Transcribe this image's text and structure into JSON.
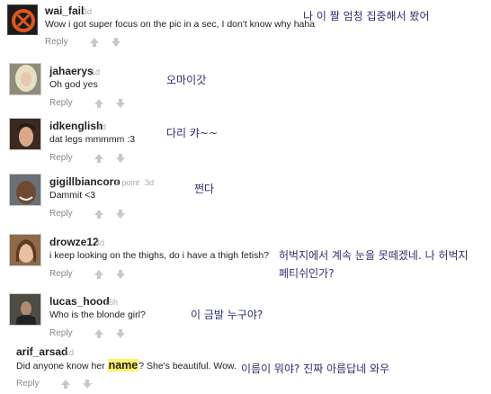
{
  "comments": [
    {
      "username": "wai_fail",
      "time": "3d",
      "points": "",
      "text": "Wow i got super focus on the pic in a sec, I don't know why haha",
      "reply": "Reply",
      "note": "나 이 짤 엄청 집중해서 봤어",
      "avatar": "orange-logo-avatar"
    },
    {
      "username": "jahaerys",
      "time": "1d",
      "points": "",
      "text": "Oh god yes",
      "reply": "Reply",
      "note": "오마이갓",
      "avatar": "blonde-person-avatar"
    },
    {
      "username": "idkenglish",
      "time": "1d",
      "points": "",
      "text": "dat legs mmmmm :3",
      "reply": "Reply",
      "note": "다리 캬~~",
      "avatar": "dark-hair-person-avatar"
    },
    {
      "username": "gigillbiancoro",
      "time": "3d",
      "points": "1 point",
      "text": "Dammit <3",
      "reply": "Reply",
      "note": "쩐다",
      "avatar": "smiling-man-avatar"
    },
    {
      "username": "drowze12",
      "time": "3d",
      "points": "",
      "text": "i keep looking on the thighs, do i have a thigh fetish?",
      "reply": "Reply",
      "note": "허벅지에서 계속 눈을 못떼겠네. 나 허벅지",
      "note2": "페티쉬인가?",
      "avatar": "brunette-woman-avatar"
    },
    {
      "username": "lucas_hood",
      "time": "16h",
      "points": "",
      "text": "Who is the blonde girl?",
      "reply": "Reply",
      "note": "이 금발 누구야?",
      "avatar": "dark-figure-avatar"
    },
    {
      "username": "arif_arsad",
      "time": "1d",
      "points": "",
      "text_before": "Did anyone know her ",
      "text_highlight": "name",
      "text_after": "? She's beautiful. Wow.",
      "reply": "Reply",
      "note": "이름이 뭐야? 진짜 아름답네 와우",
      "avatar": ""
    }
  ],
  "colors": {
    "annotation": "#2d2f6e",
    "highlight": "#fff36a",
    "vote": "#c8c8c8",
    "meta": "#aaaaaa"
  }
}
